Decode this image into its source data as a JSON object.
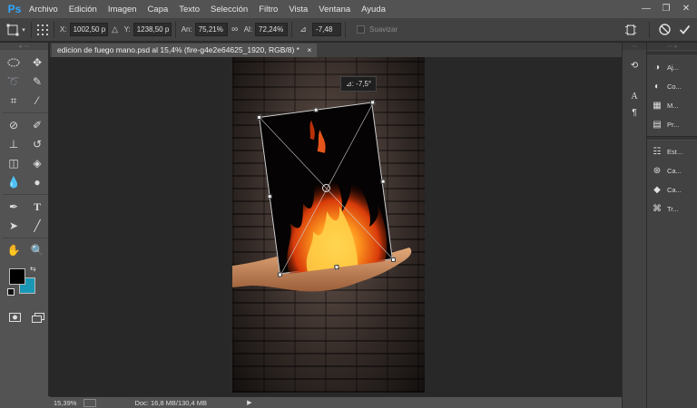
{
  "app": {
    "logo": "Ps"
  },
  "menu": [
    "Archivo",
    "Edición",
    "Imagen",
    "Capa",
    "Texto",
    "Selección",
    "Filtro",
    "Vista",
    "Ventana",
    "Ayuda"
  ],
  "window_controls": {
    "minimize": "—",
    "restore": "❐",
    "close": "✕"
  },
  "options": {
    "x_label": "X:",
    "x_value": "1002,50 p",
    "y_label": "Y:",
    "y_value": "1238,50 p",
    "w_label": "An:",
    "w_value": "75,21%",
    "h_label": "Al:",
    "h_value": "72,24%",
    "angle_value": "-7,48",
    "smooth_label": "Suavizar"
  },
  "document": {
    "tab_title": "edicion de fuego mano.psd al 15,4% (fire-g4e2e64625_1920, RGB/8) *",
    "close": "×",
    "angle_tooltip": "⊿: -7,5°"
  },
  "status": {
    "zoom": "15,39%",
    "doc": "Doc: 16,8 MB/130,4 MB"
  },
  "colors": {
    "foreground": "#000000",
    "background": "#1a97b5",
    "accent": "#31a8ff"
  },
  "right_panel": {
    "group1": [
      {
        "icon": "adjustments-icon",
        "label": "Aj..."
      },
      {
        "icon": "color-icon",
        "label": "Co..."
      },
      {
        "icon": "swatches-icon",
        "label": "M..."
      },
      {
        "icon": "properties-icon",
        "label": "Pr..."
      }
    ],
    "group2": [
      {
        "icon": "styles-icon",
        "label": "Est..."
      },
      {
        "icon": "channels-icon",
        "label": "Ca..."
      },
      {
        "icon": "layers-icon",
        "label": "Ca..."
      },
      {
        "icon": "paths-icon",
        "label": "Tr..."
      }
    ]
  }
}
